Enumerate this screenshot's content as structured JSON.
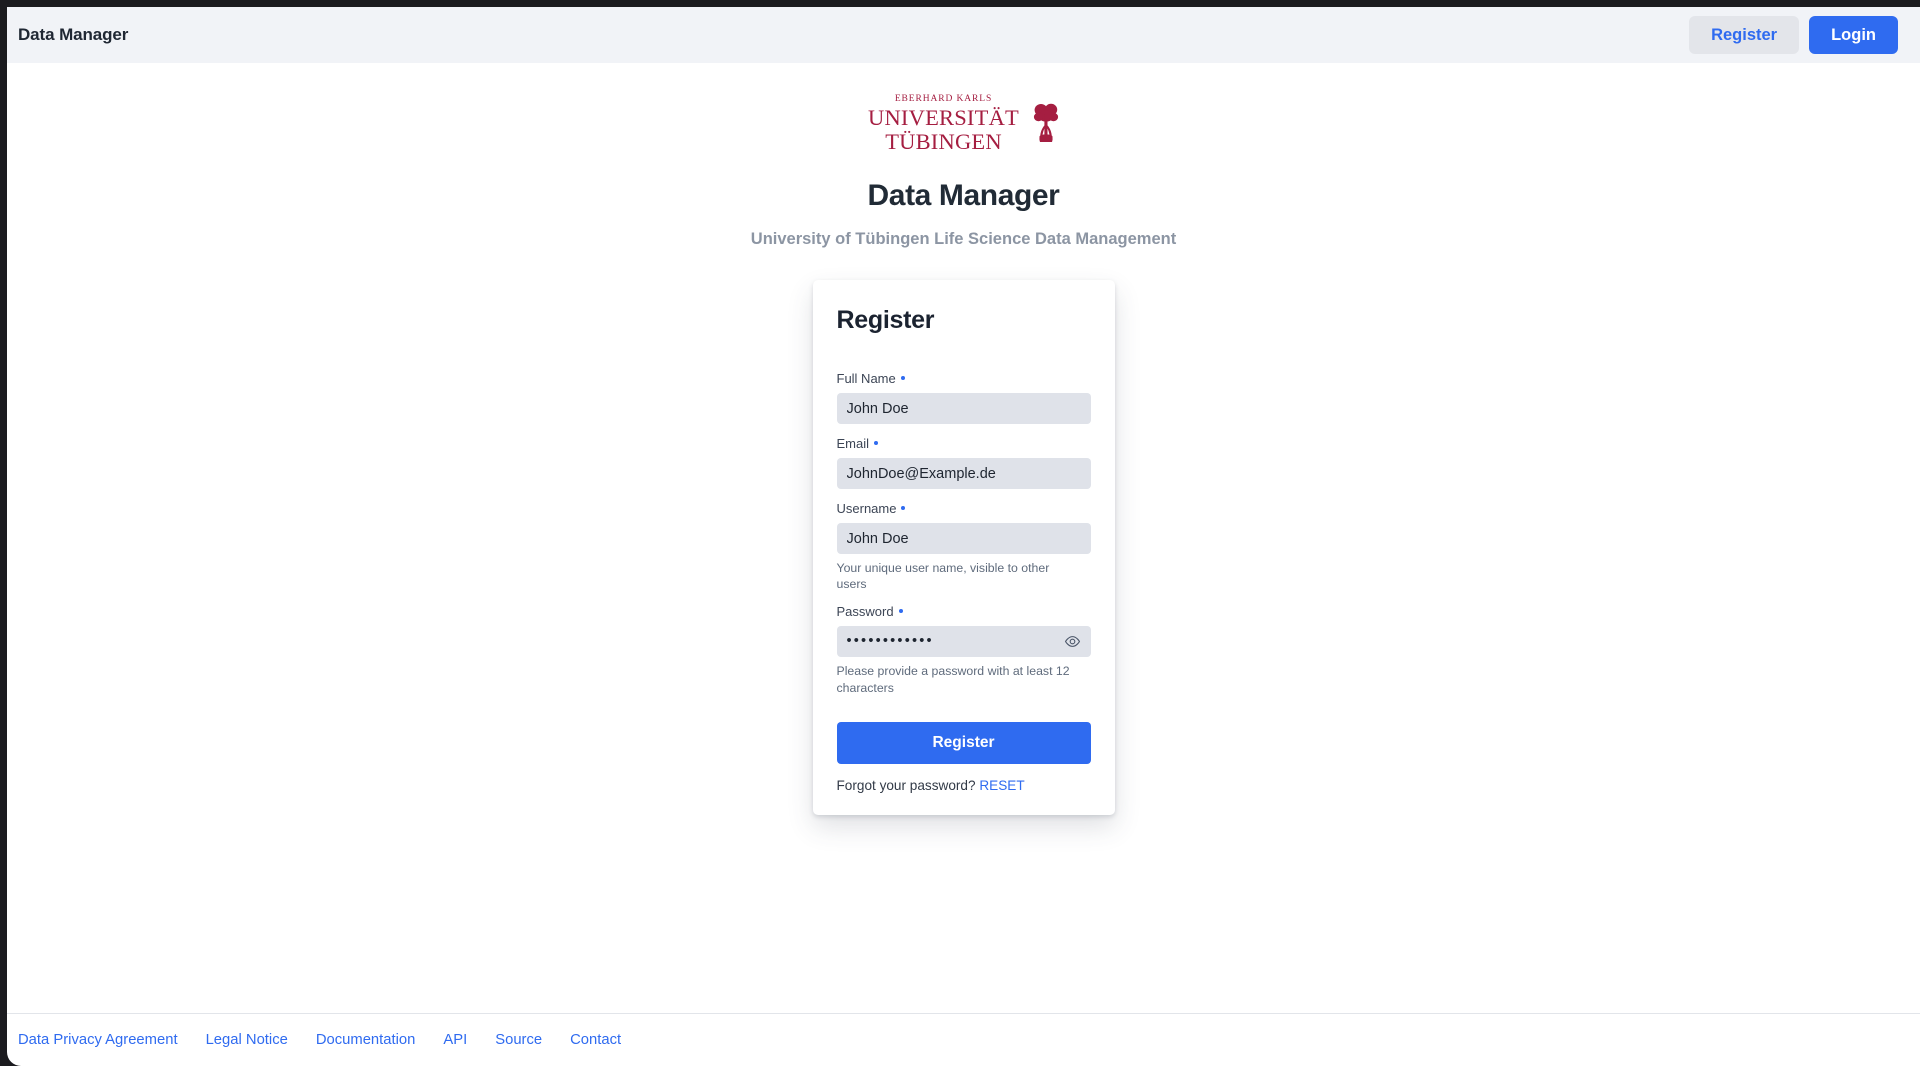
{
  "header": {
    "app_title": "Data Manager",
    "register_button": "Register",
    "login_button": "Login"
  },
  "logo": {
    "line1": "EBERHARD KARLS",
    "line2": "UNIVERSITÄT",
    "line3": "TÜBINGEN",
    "emblem": "tree-emblem-icon",
    "color": "#a51e41"
  },
  "hero": {
    "title": "Data Manager",
    "subtitle": "University of Tübingen Life Science Data Management"
  },
  "card": {
    "title": "Register",
    "fields": [
      {
        "key": "full_name",
        "label": "Full Name",
        "required_marker": "•",
        "value": "John Doe",
        "placeholder": "",
        "hint": ""
      },
      {
        "key": "email",
        "label": "Email",
        "required_marker": "•",
        "value": "JohnDoe@Example.de",
        "placeholder": "",
        "hint": ""
      },
      {
        "key": "username",
        "label": "Username",
        "required_marker": "•",
        "value": "John Doe",
        "placeholder": "",
        "hint": "Your unique user name, visible to other users"
      },
      {
        "key": "password",
        "label": "Password",
        "required_marker": "•",
        "value": "••••••••••••",
        "placeholder": "",
        "hint": "Please provide a password with at least 12 characters",
        "toggle_icon": "eye-icon"
      }
    ],
    "submit_label": "Register",
    "forgot_text": "Forgot your password?",
    "reset_link": "RESET"
  },
  "footer": {
    "links": [
      "Data Privacy Agreement",
      "Legal Notice",
      "Documentation",
      "API",
      "Source",
      "Contact"
    ]
  },
  "colors": {
    "accent": "#2f6bf0",
    "header_bg": "#f1f3f7",
    "input_bg": "#dfe2e9",
    "brand_red": "#a51e41"
  }
}
